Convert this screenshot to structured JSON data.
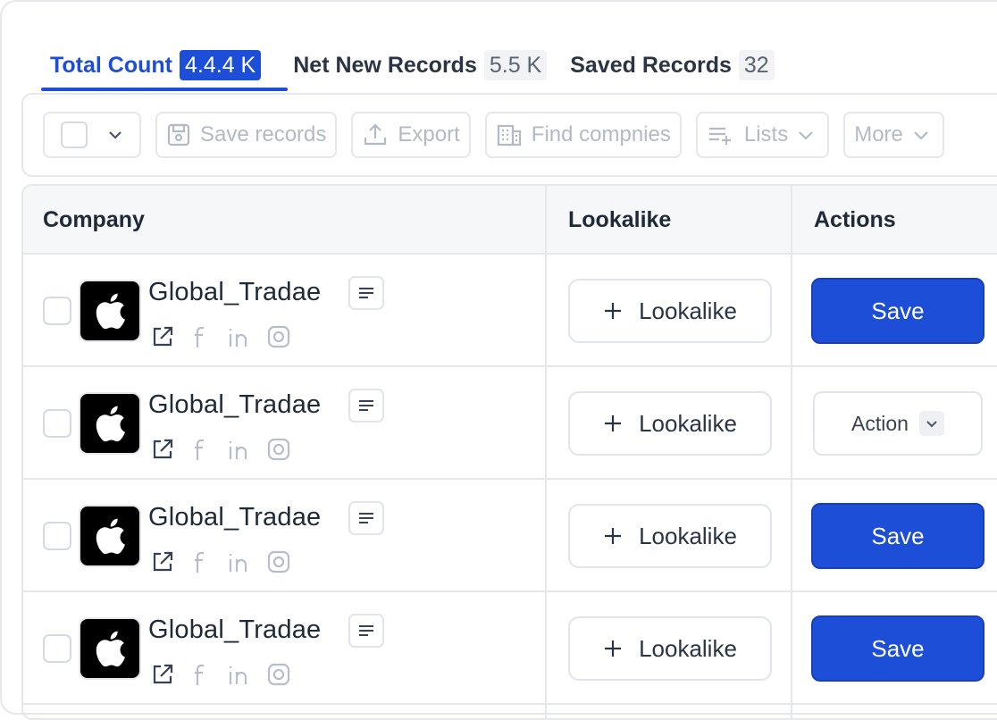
{
  "tabs": [
    {
      "label": "Total Count",
      "count": "4.4.4 K",
      "active": true
    },
    {
      "label": "Net New Records",
      "count": "5.5 K",
      "active": false
    },
    {
      "label": "Saved Records",
      "count": "32",
      "active": false
    }
  ],
  "toolbar": {
    "save_records": "Save records",
    "export": "Export",
    "find_companies": "Find compnies",
    "lists": "Lists",
    "more": "More"
  },
  "table": {
    "headers": {
      "company": "Company",
      "lookalike": "Lookalike",
      "actions": "Actions"
    },
    "rows": [
      {
        "company": "Global_Tradae",
        "lookalike_label": "Lookalike",
        "action_label": "Save",
        "action_type": "save"
      },
      {
        "company": "Global_Tradae",
        "lookalike_label": "Lookalike",
        "action_label": "Action",
        "action_type": "dropdown"
      },
      {
        "company": "Global_Tradae",
        "lookalike_label": "Lookalike",
        "action_label": "Save",
        "action_type": "save"
      },
      {
        "company": "Global_Tradae",
        "lookalike_label": "Lookalike",
        "action_label": "Save",
        "action_type": "save"
      }
    ]
  },
  "icons": {
    "logo": "apple-icon",
    "socials": [
      "external-link-icon",
      "facebook-icon",
      "linkedin-icon",
      "instagram-icon"
    ]
  },
  "colors": {
    "accent": "#1d4ed8",
    "border": "#e5e7eb",
    "muted": "#b4bac3"
  }
}
